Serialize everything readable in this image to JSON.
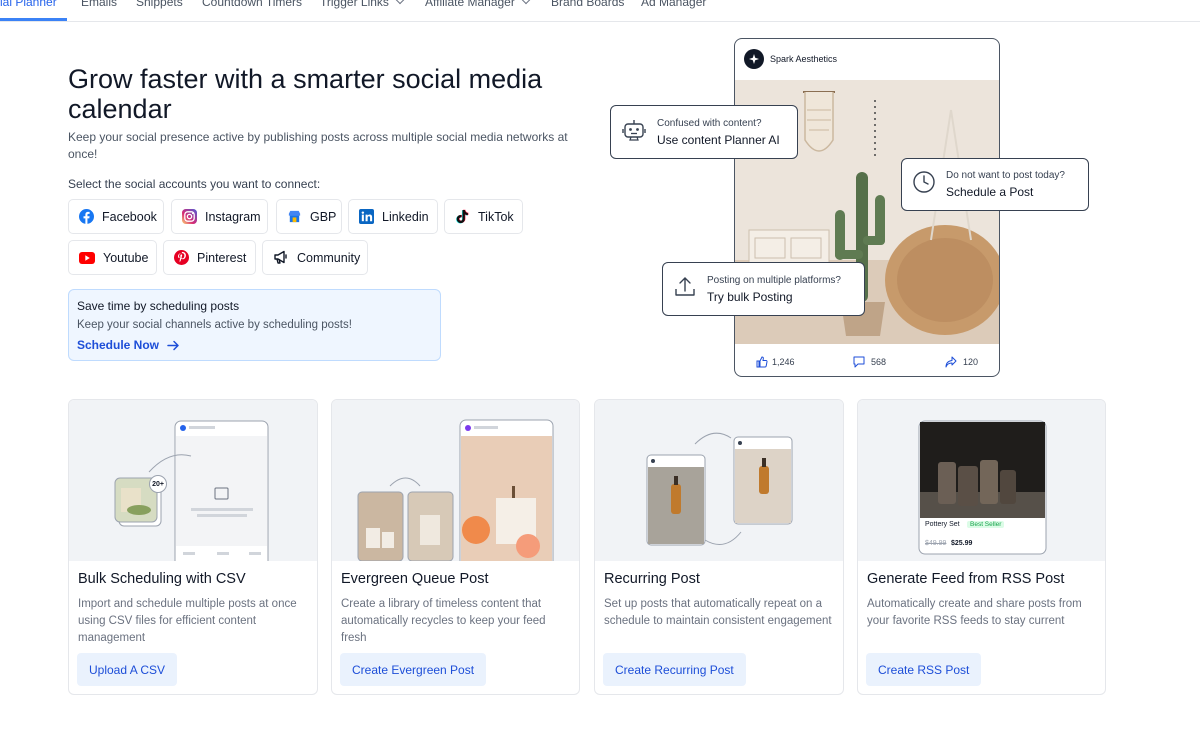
{
  "nav": {
    "tabs": [
      {
        "label": "cial Planner",
        "active": true
      },
      {
        "label": "Emails"
      },
      {
        "label": "Snippets"
      },
      {
        "label": "Countdown Timers"
      },
      {
        "label": "Trigger Links"
      },
      {
        "label": "Affiliate Manager"
      },
      {
        "label": "Brand Boards"
      },
      {
        "label": "Ad Manager"
      }
    ]
  },
  "hero": {
    "title": "Grow faster with a smarter social media calendar",
    "subtitle": "Keep your social presence active by publishing posts across multiple social media networks at once!",
    "select_label": "Select the social accounts you want to connect:"
  },
  "accounts": [
    {
      "label": "Facebook",
      "icon": "facebook-icon",
      "color": "#1877f2"
    },
    {
      "label": "Instagram",
      "icon": "instagram-icon",
      "color": "#e1306c"
    },
    {
      "label": "GBP",
      "icon": "gbp-icon",
      "color": "#4285f4"
    },
    {
      "label": "Linkedin",
      "icon": "linkedin-icon",
      "color": "#0a66c2"
    },
    {
      "label": "TikTok",
      "icon": "tiktok-icon",
      "color": "#000000"
    },
    {
      "label": "Youtube",
      "icon": "youtube-icon",
      "color": "#ff0000"
    },
    {
      "label": "Pinterest",
      "icon": "pinterest-icon",
      "color": "#e60023"
    },
    {
      "label": "Community",
      "icon": "megaphone-icon",
      "color": "#111827"
    }
  ],
  "promo": {
    "title": "Save time by scheduling posts",
    "text": "Keep your social channels active by scheduling posts!",
    "link": "Schedule Now"
  },
  "preview": {
    "account": "Spark Aesthetics",
    "likes": "1,246",
    "comments": "568",
    "shares": "120",
    "callouts": {
      "ai": {
        "line1": "Confused with content?",
        "line2": "Use content Planner AI"
      },
      "schedule": {
        "line1": "Do not want to post today?",
        "line2": "Schedule a Post"
      },
      "bulk": {
        "line1": "Posting on multiple platforms?",
        "line2": "Try bulk Posting"
      }
    }
  },
  "cards": [
    {
      "title": "Bulk Scheduling with CSV",
      "desc": "Import and schedule multiple posts at once using CSV files for efficient content management",
      "button": "Upload A CSV",
      "badge": "20+"
    },
    {
      "title": "Evergreen Queue Post",
      "desc": "Create a library of timeless content that automatically recycles to keep your feed fresh",
      "button": "Create Evergreen Post"
    },
    {
      "title": "Recurring Post",
      "desc": "Set up posts that automatically repeat on a schedule to maintain consistent engagement",
      "button": "Create Recurring Post"
    },
    {
      "title": "Generate Feed from RSS Post",
      "desc": "Automatically create and share posts from your favorite RSS feeds to stay current",
      "button": "Create RSS Post",
      "product": {
        "name": "Pottery Set",
        "badge": "Best Seller",
        "old_price": "$49.99",
        "price": "$25.99"
      }
    }
  ]
}
